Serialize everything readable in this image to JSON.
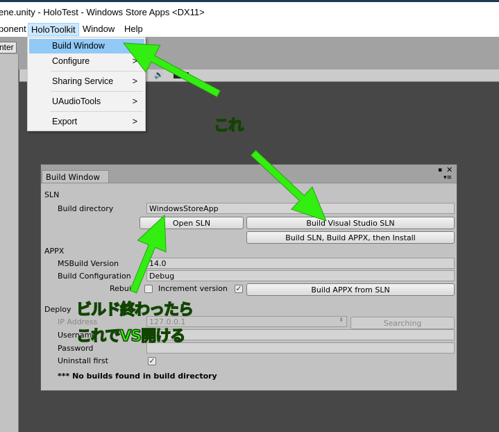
{
  "window_title": "ene.unity - HoloTest - Windows Store Apps <DX11>",
  "menubar": {
    "items": [
      "ponent",
      "HoloToolkit",
      "Window",
      "Help"
    ],
    "open": "HoloToolkit"
  },
  "toolbar": {
    "pivot_label": "nter"
  },
  "dropdown": {
    "items": [
      {
        "label": "Build Window",
        "submenu": false,
        "highlighted": true
      },
      {
        "label": "Configure",
        "submenu": true
      },
      {
        "label": "Sharing Service",
        "submenu": true
      },
      {
        "label": "UAudioTools",
        "submenu": true
      },
      {
        "label": "Export",
        "submenu": true
      }
    ],
    "chevron": ">"
  },
  "build_window": {
    "tab": "Build Window",
    "sln": {
      "header": "SLN",
      "build_dir_label": "Build directory",
      "build_dir_value": "WindowsStoreApp",
      "open_sln": "Open SLN",
      "build_vs_sln": "Build Visual Studio SLN",
      "build_all": "Build SLN, Build APPX, then Install"
    },
    "appx": {
      "header": "APPX",
      "msbuild_label": "MSBuild Version",
      "msbuild_value": "14.0",
      "config_label": "Build Configuration",
      "config_value": "Debug",
      "rebuild_label": "Rebuild",
      "rebuild_checked": false,
      "increment_label": "Increment version",
      "increment_checked": true,
      "build_appx": "Build APPX from SLN"
    },
    "deploy": {
      "header": "Deploy",
      "ip_label": "IP Address",
      "ip_value": "127.0.0.1",
      "searching": "Searching",
      "username_label": "Username",
      "password_label": "Password",
      "uninstall_label": "Uninstall first",
      "uninstall_checked": true
    },
    "message": "*** No builds found in build directory"
  },
  "annotations": {
    "kore": "これ",
    "build_done": "ビルド終わったら",
    "open_vs": "これでVS開ける",
    "color": "#33ee11"
  }
}
